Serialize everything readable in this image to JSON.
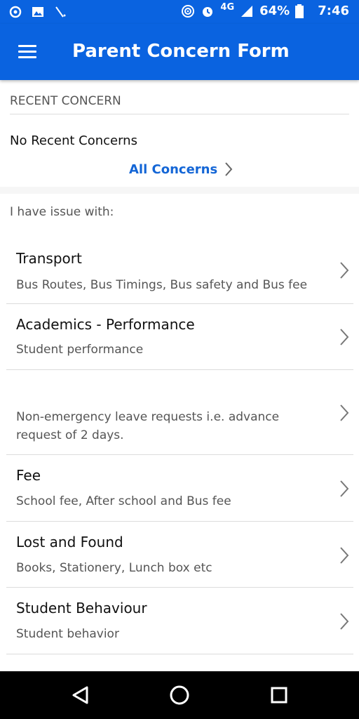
{
  "status_bar": {
    "network": "4G",
    "battery": "64%",
    "time": "7:46"
  },
  "app_bar": {
    "title": "Parent Concern Form"
  },
  "recent": {
    "header": "RECENT CONCERN",
    "empty_text": "No Recent Concerns",
    "link_label": "All Concerns"
  },
  "issue_prompt": "I have issue with:",
  "items": [
    {
      "title": "Transport",
      "subtitle": "Bus Routes, Bus Timings, Bus safety and Bus fee"
    },
    {
      "title": "Academics - Performance",
      "subtitle": "Student performance"
    },
    {
      "title": "",
      "subtitle": "Non-emergency leave requests i.e. advance request of 2 days."
    },
    {
      "title": "Fee",
      "subtitle": "School fee, After school and Bus fee"
    },
    {
      "title": "Lost and Found",
      "subtitle": "Books, Stationery, Lunch box etc"
    },
    {
      "title": "Student Behaviour",
      "subtitle": "Student behavior"
    }
  ],
  "icons": {
    "menu": "hamburger-icon",
    "chevron": "chevron-right-icon",
    "back": "back-triangle-icon",
    "home": "home-circle-icon",
    "recents": "recents-square-icon"
  },
  "colors": {
    "primary": "#0a63e0",
    "link": "#1466d6"
  }
}
